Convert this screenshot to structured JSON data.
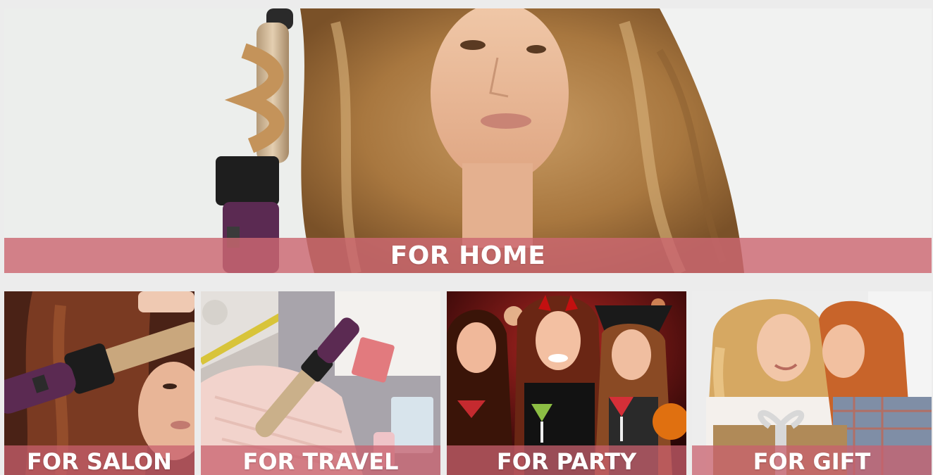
{
  "hero": {
    "label": "FOR HOME",
    "banner_color": "#cc6871"
  },
  "tiles": [
    {
      "id": "salon",
      "label": "FOR SALON"
    },
    {
      "id": "travel",
      "label": "FOR TRAVEL"
    },
    {
      "id": "party",
      "label": "FOR PARTY"
    },
    {
      "id": "gift",
      "label": "FOR GIFT"
    }
  ],
  "icons": {
    "hero_image": "woman-curling-hair-photo",
    "salon_image": "salon-curling-iron-photo",
    "travel_image": "packed-suitcase-photo",
    "party_image": "party-women-photo",
    "gift_image": "mother-child-gift-photo"
  }
}
